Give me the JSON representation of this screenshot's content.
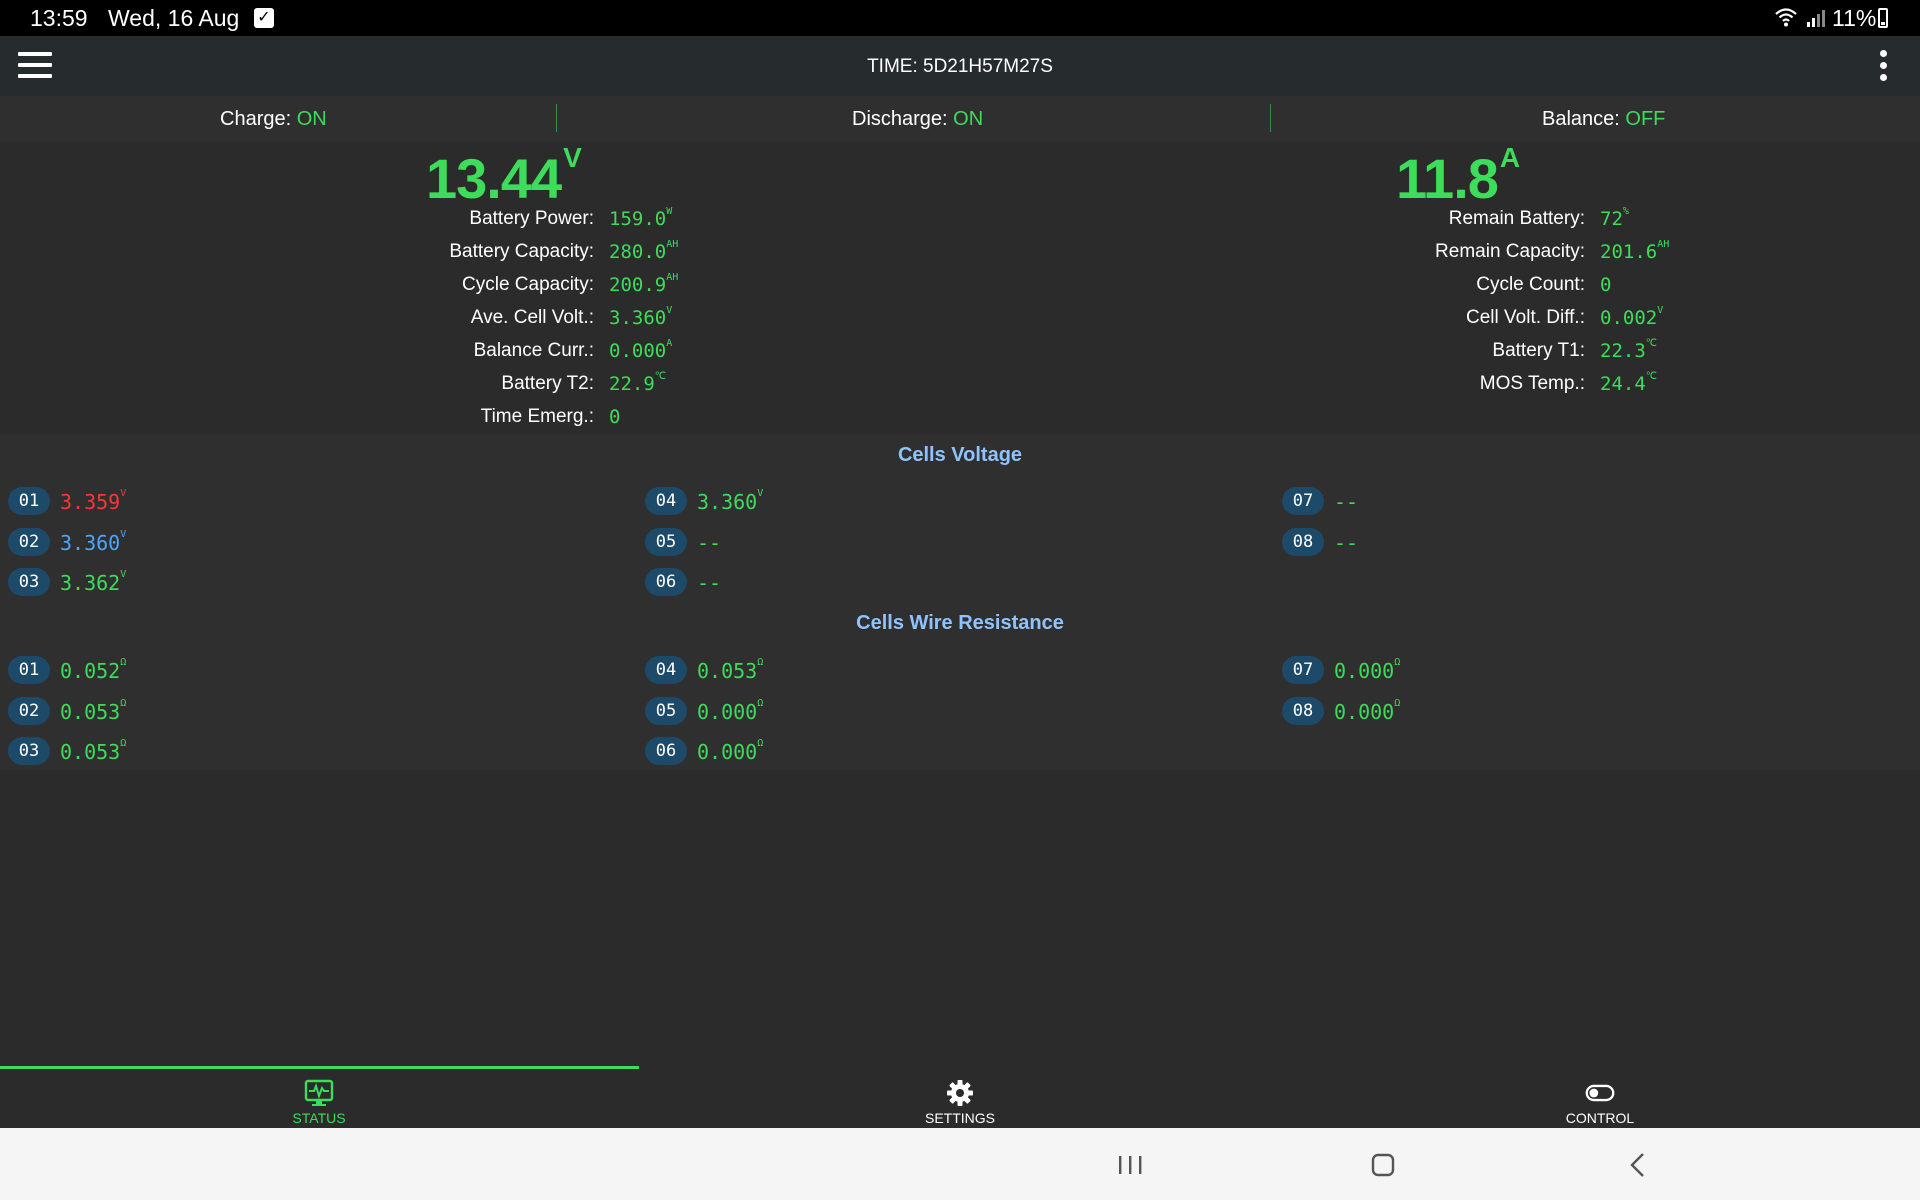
{
  "statusbar": {
    "time": "13:59",
    "date": "Wed, 16 Aug",
    "battery": "11%"
  },
  "appbar": {
    "title": "TIME: 5D21H57M27S"
  },
  "switches": {
    "charge_label": "Charge:",
    "charge_value": "ON",
    "discharge_label": "Discharge:",
    "discharge_value": "ON",
    "balance_label": "Balance:",
    "balance_value": "OFF"
  },
  "voltage": {
    "value": "13.44",
    "unit": "V"
  },
  "current": {
    "value": "11.8",
    "unit": "A"
  },
  "left_info": [
    {
      "label": "Battery Power:",
      "value": "159.0",
      "unit": "W"
    },
    {
      "label": "Battery Capacity:",
      "value": "280.0",
      "unit": "AH"
    },
    {
      "label": "Cycle Capacity:",
      "value": "200.9",
      "unit": "AH"
    },
    {
      "label": "Ave. Cell Volt.:",
      "value": "3.360",
      "unit": "V"
    },
    {
      "label": "Balance Curr.:",
      "value": "0.000",
      "unit": "A"
    },
    {
      "label": "Battery T2:",
      "value": "22.9",
      "unit": "℃"
    },
    {
      "label": "Time Emerg.:",
      "value": "0",
      "unit": ""
    }
  ],
  "right_info": [
    {
      "label": "Remain Battery:",
      "value": "72",
      "unit": "%"
    },
    {
      "label": "Remain Capacity:",
      "value": "201.6",
      "unit": "AH"
    },
    {
      "label": "Cycle Count:",
      "value": "0",
      "unit": ""
    },
    {
      "label": "Cell Volt. Diff.:",
      "value": "0.002",
      "unit": "V"
    },
    {
      "label": "Battery T1:",
      "value": "22.3",
      "unit": "℃"
    },
    {
      "label": "MOS Temp.:",
      "value": "24.4",
      "unit": "℃"
    }
  ],
  "cells_voltage": {
    "title": "Cells Voltage",
    "cells": [
      {
        "id": "01",
        "value": "3.359",
        "unit": "V",
        "color": "#ff3535"
      },
      {
        "id": "02",
        "value": "3.360",
        "unit": "V",
        "color": "#4aa6ff"
      },
      {
        "id": "03",
        "value": "3.362",
        "unit": "V",
        "color": "#3ddc5a"
      },
      {
        "id": "04",
        "value": "3.360",
        "unit": "V",
        "color": "#3ddc5a"
      },
      {
        "id": "05",
        "value": "--",
        "unit": "",
        "color": "#3ddc5a"
      },
      {
        "id": "06",
        "value": "--",
        "unit": "",
        "color": "#3ddc5a"
      },
      {
        "id": "07",
        "value": "--",
        "unit": "",
        "color": "#3ddc5a"
      },
      {
        "id": "08",
        "value": "--",
        "unit": "",
        "color": "#3ddc5a"
      }
    ]
  },
  "cells_resistance": {
    "title": "Cells Wire Resistance",
    "cells": [
      {
        "id": "01",
        "value": "0.052",
        "unit": "Ω"
      },
      {
        "id": "02",
        "value": "0.053",
        "unit": "Ω"
      },
      {
        "id": "03",
        "value": "0.053",
        "unit": "Ω"
      },
      {
        "id": "04",
        "value": "0.053",
        "unit": "Ω"
      },
      {
        "id": "05",
        "value": "0.000",
        "unit": "Ω"
      },
      {
        "id": "06",
        "value": "0.000",
        "unit": "Ω"
      },
      {
        "id": "07",
        "value": "0.000",
        "unit": "Ω"
      },
      {
        "id": "08",
        "value": "0.000",
        "unit": "Ω"
      }
    ]
  },
  "tabs": [
    {
      "label": "STATUS",
      "icon": "monitor-heartbeat-icon",
      "active": true
    },
    {
      "label": "SETTINGS",
      "icon": "gear-icon",
      "active": false
    },
    {
      "label": "CONTROL",
      "icon": "toggle-icon",
      "active": false
    }
  ],
  "colors": {
    "accent": "#3ddc5a",
    "title_blue": "#8ec3ff",
    "badge": "#1e4a6a"
  }
}
